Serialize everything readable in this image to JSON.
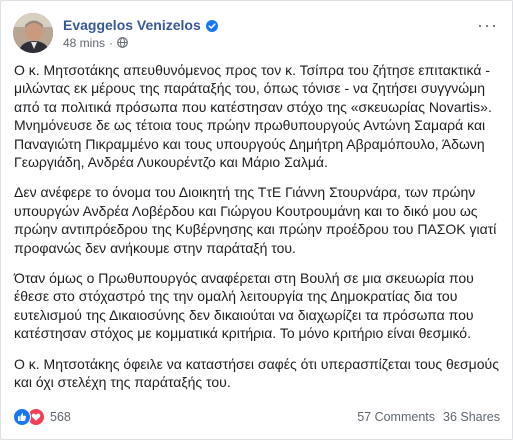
{
  "post": {
    "author": "Evaggelos Venizelos",
    "verified_icon": "verified-badge-icon",
    "time": "48 mins",
    "separator": "·",
    "audience_icon": "globe-icon",
    "more_icon": "more-options-icon",
    "more_glyph": "···",
    "paragraphs": [
      "Ο κ. Μητσοτάκης απευθυνόμενος προς τον κ. Τσίπρα του ζήτησε επιτακτικά - μιλώντας εκ μέρους της παράταξής του, όπως τόνισε - να ζητήσει συγγνώμη από τα πολιτικά πρόσωπα που κατέστησαν στόχο της «σκευωρίας Novartis». Μνημόνευσε δε ως τέτοια τους πρώην πρωθυπουργούς Αντώνη Σαμαρά και Παναγιώτη Πικραμμένο και τους υπουργούς Δημήτρη Αβραμόπουλο, Άδωνη Γεωργιάδη, Ανδρέα Λυκουρέντζο και Μάριο Σαλμά.",
      "Δεν ανέφερε το όνομα του Διοικητή της ΤτΕ Γιάννη Στουρνάρα, των πρώην υπουργών Ανδρέα Λοβέρδου και Γιώργου Κουτρουμάνη και το δικό μου ως πρώην αντιπρόεδρου της Κυβέρνησης και πρώην προέδρου του ΠΑΣΟΚ γιατί προφανώς δεν ανήκουμε στην παράταξή του.",
      "Όταν όμως ο Πρωθυπουργός αναφέρεται στη Βουλή σε μια σκευωρία που έθεσε στο στόχαστρό της την ομαλή λειτουργία της Δημοκρατίας δια του ευτελισμού της Δικαιοσύνης δεν δικαιούται να διαχωρίζει τα πρόσωπα που κατέστησαν στόχος με κομματικά κριτήρια. Το μόνο κριτήριο είναι θεσμικό.",
      "Ο κ. Μητσοτάκης όφειλε να καταστήσει σαφές ότι υπερασπίζεται τους θεσμούς και όχι στελέχη της παράταξής του."
    ],
    "reactions": {
      "icons": [
        "like-icon",
        "love-icon"
      ],
      "count": "568"
    },
    "comments": "57 Comments",
    "shares": "36 Shares",
    "colors": {
      "author": "#385898",
      "like": "#1877f2",
      "love": "#f33e58",
      "text": "#1c1e21",
      "meta": "#616770"
    }
  }
}
